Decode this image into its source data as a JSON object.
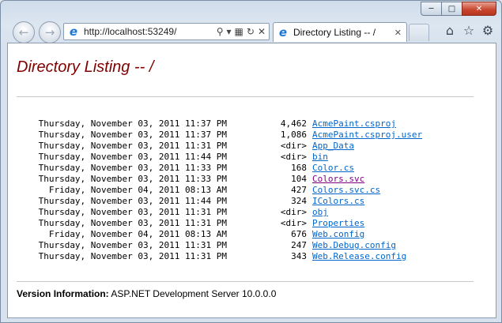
{
  "browser": {
    "address": "http://localhost:53249/",
    "tab_title": "Directory Listing -- /",
    "tab_close": "✕",
    "back_glyph": "←",
    "forward_glyph": "→",
    "icons": [
      "home-icon",
      "star-icon",
      "gear-icon"
    ]
  },
  "page": {
    "heading": "Directory Listing -- /",
    "entries": [
      {
        "date": "Thursday, November 03, 2011 11:37 PM",
        "size": "4,462",
        "name": "AcmePaint.csproj"
      },
      {
        "date": "Thursday, November 03, 2011 11:37 PM",
        "size": "1,086",
        "name": "AcmePaint.csproj.user"
      },
      {
        "date": "Thursday, November 03, 2011 11:31 PM",
        "size": "<dir>",
        "name": "App_Data"
      },
      {
        "date": "Thursday, November 03, 2011 11:44 PM",
        "size": "<dir>",
        "name": "bin"
      },
      {
        "date": "Thursday, November 03, 2011 11:33 PM",
        "size": "168",
        "name": "Color.cs"
      },
      {
        "date": "Thursday, November 03, 2011 11:33 PM",
        "size": "104",
        "name": "Colors.svc"
      },
      {
        "date": "Friday, November 04, 2011 08:13 AM",
        "size": "427",
        "name": "Colors.svc.cs"
      },
      {
        "date": "Thursday, November 03, 2011 11:44 PM",
        "size": "324",
        "name": "IColors.cs"
      },
      {
        "date": "Thursday, November 03, 2011 11:31 PM",
        "size": "<dir>",
        "name": "obj"
      },
      {
        "date": "Thursday, November 03, 2011 11:31 PM",
        "size": "<dir>",
        "name": "Properties"
      },
      {
        "date": "Friday, November 04, 2011 08:13 AM",
        "size": "676",
        "name": "Web.config"
      },
      {
        "date": "Thursday, November 03, 2011 11:31 PM",
        "size": "247",
        "name": "Web.Debug.config"
      },
      {
        "date": "Thursday, November 03, 2011 11:31 PM",
        "size": "343",
        "name": "Web.Release.config"
      }
    ],
    "version_label": "Version Information:",
    "version_value": "ASP.NET Development Server 10.0.0.0"
  },
  "colors": {
    "heading": "#800000",
    "link": "#0066cc",
    "visited_link": "#800080"
  }
}
